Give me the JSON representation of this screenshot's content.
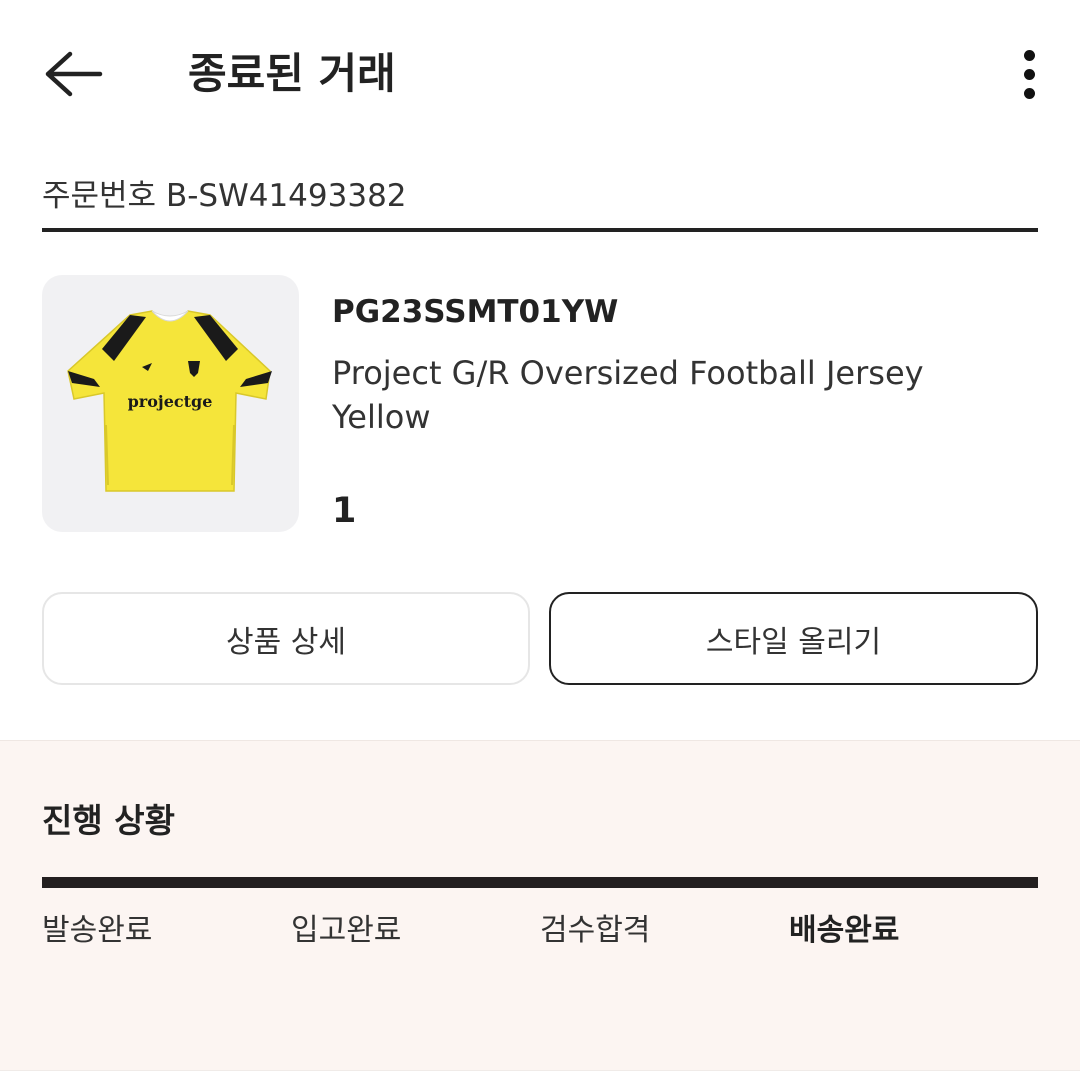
{
  "header": {
    "title": "종료된 거래",
    "back_icon": "arrow-left-icon",
    "more_icon": "more-vertical-icon"
  },
  "order": {
    "label": "주문번호",
    "number": "B-SW41493382"
  },
  "product": {
    "model": "PG23SSMT01YW",
    "name": "Project G/R Oversized Football Jersey Yellow",
    "quantity": "1",
    "image_text": "projectge"
  },
  "buttons": {
    "detail": "상품 상세",
    "style": "스타일 올리기"
  },
  "status": {
    "title": "진행 상황",
    "steps": [
      {
        "label": "발송완료",
        "active": false
      },
      {
        "label": "입고완료",
        "active": false
      },
      {
        "label": "검수합격",
        "active": false
      },
      {
        "label": "배송완료",
        "active": true
      }
    ],
    "progress": 1.0
  },
  "colors": {
    "panel_bg": "#fcf5f2",
    "bar": "#231f20",
    "jersey": "#f5e53a"
  }
}
